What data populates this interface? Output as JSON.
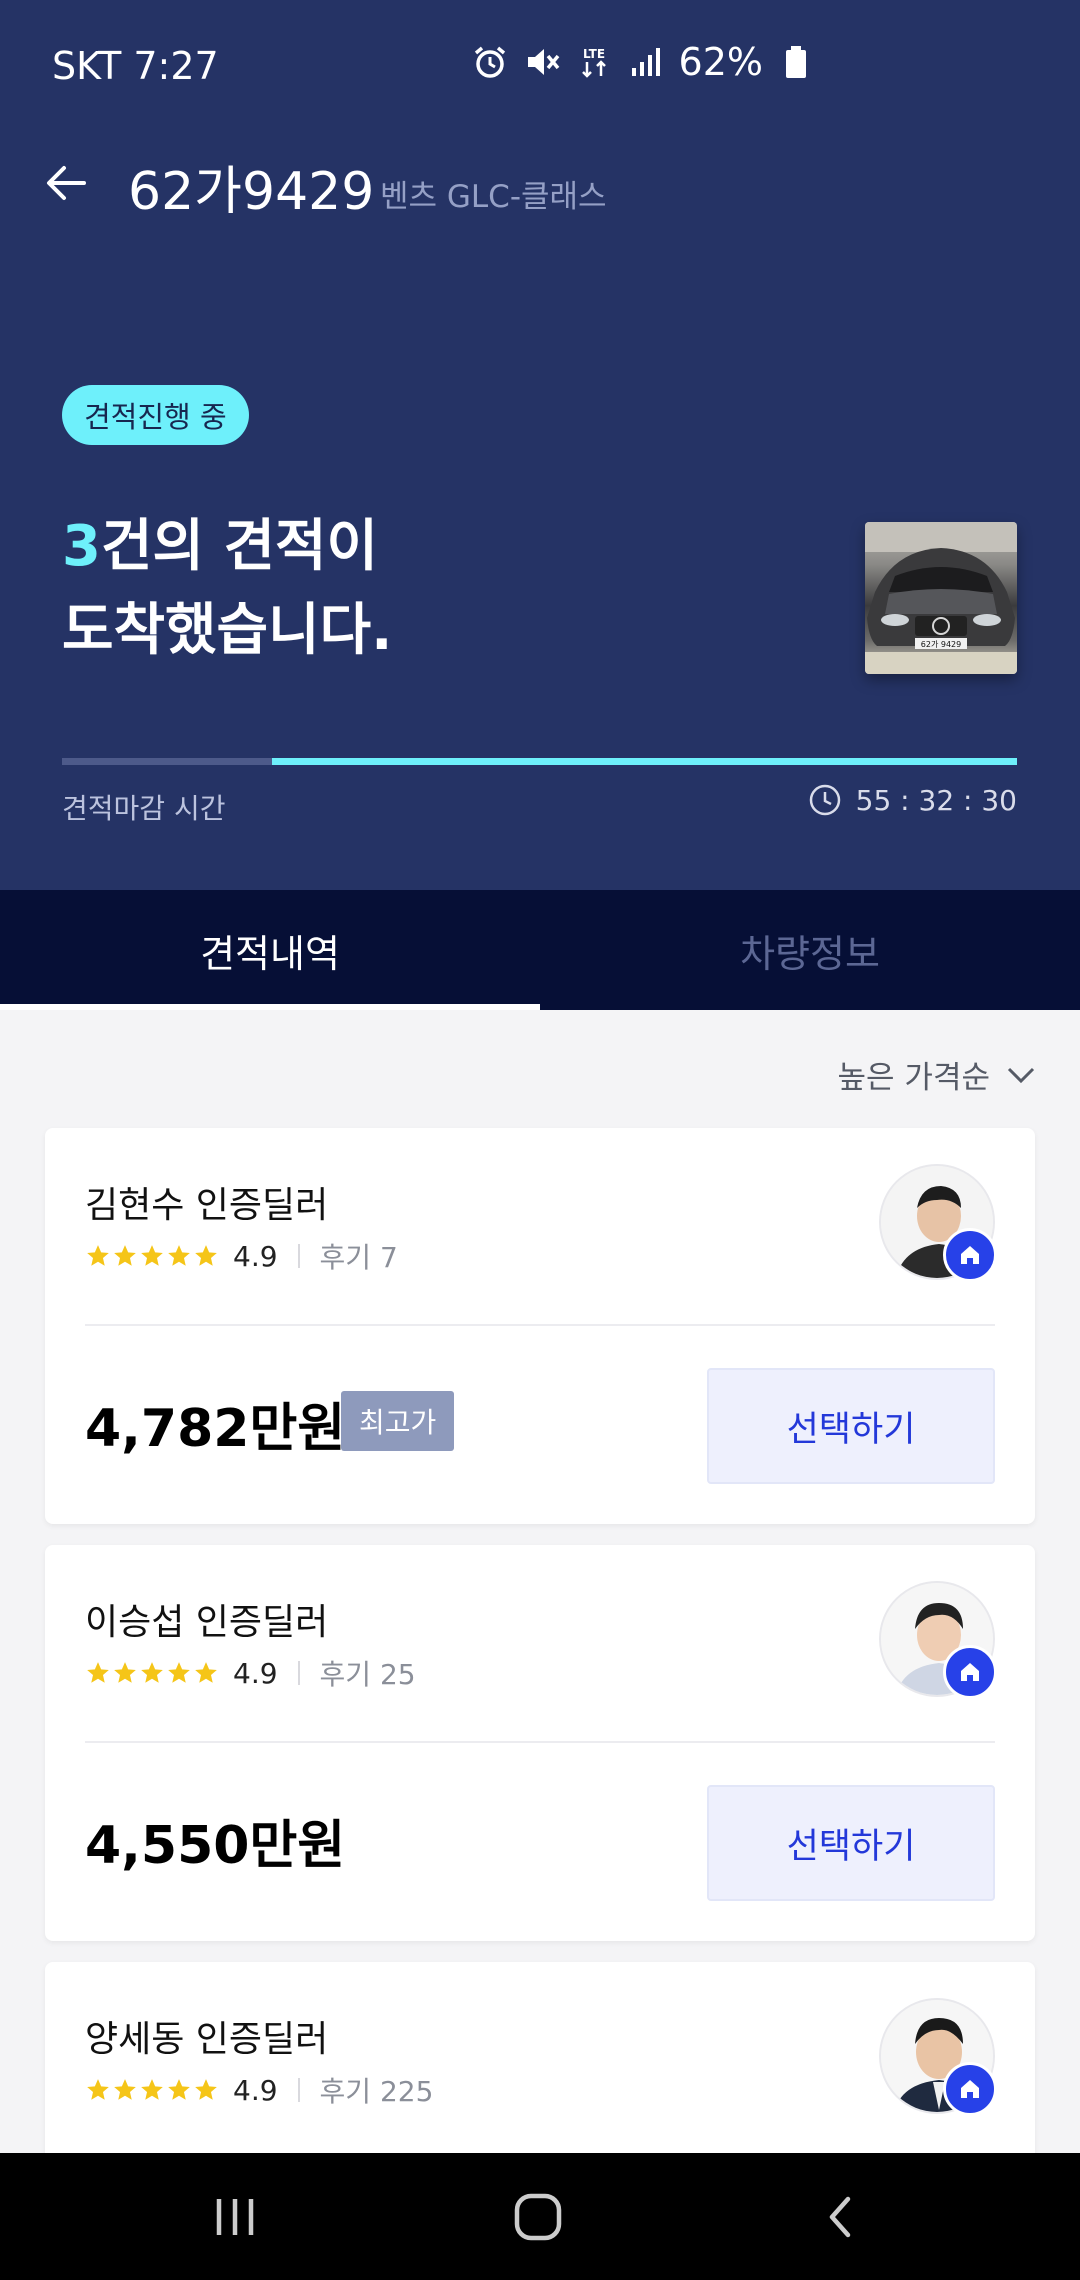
{
  "status_bar": {
    "carrier_time": "SKT 7:27",
    "network": "LTE",
    "battery": "62%"
  },
  "header": {
    "plate": "62가9429",
    "model": "벤츠 GLC-클래스"
  },
  "hero": {
    "status_chip": "견적진행 중",
    "count": "3",
    "headline_line1": "건의 견적이",
    "headline_line2": "도착했습니다.",
    "deadline_label": "견적마감 시간",
    "deadline_timer": "55 : 32 : 30",
    "deadline_progress_remaining": 0.78,
    "thumbnail_plate": "62가 9429"
  },
  "tabs": [
    {
      "label": "견적내역",
      "active": true
    },
    {
      "label": "차량정보",
      "active": false
    }
  ],
  "sort": {
    "label": "높은 가격순"
  },
  "quotes": [
    {
      "dealer": "김현수 인증딜러",
      "rating": "4.9",
      "reviews": "후기 7",
      "price": "4,782만원",
      "badge": "최고가",
      "button": "선택하기",
      "avatar_tone": "#2b2b2b"
    },
    {
      "dealer": "이승섭 인증딜러",
      "rating": "4.9",
      "reviews": "후기 25",
      "price": "4,550만원",
      "badge": "",
      "button": "선택하기",
      "avatar_tone": "#cfd6e4"
    },
    {
      "dealer": "양세동 인증딜러",
      "rating": "4.9",
      "reviews": "후기 225",
      "price": "",
      "badge": "",
      "button": "",
      "avatar_tone": "#1f2a3f"
    }
  ],
  "colors": {
    "hero_bg": "#253365",
    "accent_cyan": "#6ef0fb",
    "tab_bg": "#060f36",
    "primary_blue": "#2338d9",
    "star_yellow": "#f5c518"
  },
  "icons": {
    "back": "arrow-left-icon",
    "sort": "chevron-down-icon",
    "timer": "clock-icon",
    "badge": "house-icon",
    "rating": "star-icon"
  }
}
